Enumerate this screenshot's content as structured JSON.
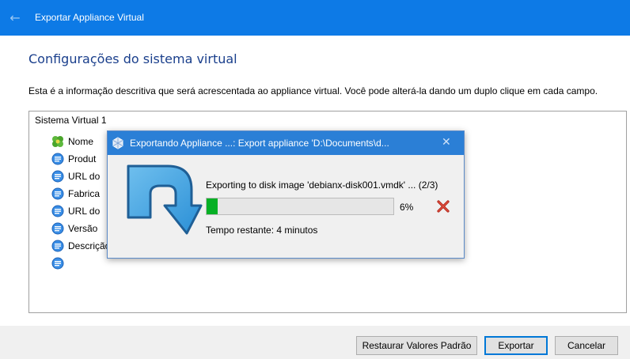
{
  "window": {
    "title": "Exportar Appliance Virtual"
  },
  "page": {
    "heading": "Configurações do sistema virtual",
    "description": "Esta é a informação descritiva que será acrescentada ao appliance virtual. Você pode alterá-la dando um duplo clique em cada campo."
  },
  "tree": {
    "root": "Sistema Virtual 1",
    "items": [
      {
        "label": "Nome",
        "icon": "vm-name-icon"
      },
      {
        "label": "Produt",
        "icon": "info-bubble-icon"
      },
      {
        "label": "URL do",
        "icon": "info-bubble-icon"
      },
      {
        "label": "Fabrica",
        "icon": "info-bubble-icon"
      },
      {
        "label": "URL do",
        "icon": "info-bubble-icon"
      },
      {
        "label": "Versão",
        "icon": "info-bubble-icon"
      },
      {
        "label": "Descrição",
        "icon": "info-bubble-icon"
      },
      {
        "label": "",
        "icon": "info-bubble-icon"
      }
    ]
  },
  "buttons": {
    "restore": "Restaurar Valores Padrão",
    "export": "Exportar",
    "cancel": "Cancelar"
  },
  "progress_dialog": {
    "title": "Exportando Appliance ...: Export appliance 'D:\\Documents\\d...",
    "status": "Exporting to disk image 'debianx-disk001.vmdk' ... (2/3)",
    "percent_label": "6%",
    "progress_fraction": 0.06,
    "remaining": "Tempo restante: 4 minutos"
  },
  "colors": {
    "titlebar": "#0d7ae6",
    "heading": "#1a3f8c",
    "progress_fill": "#06b025"
  }
}
